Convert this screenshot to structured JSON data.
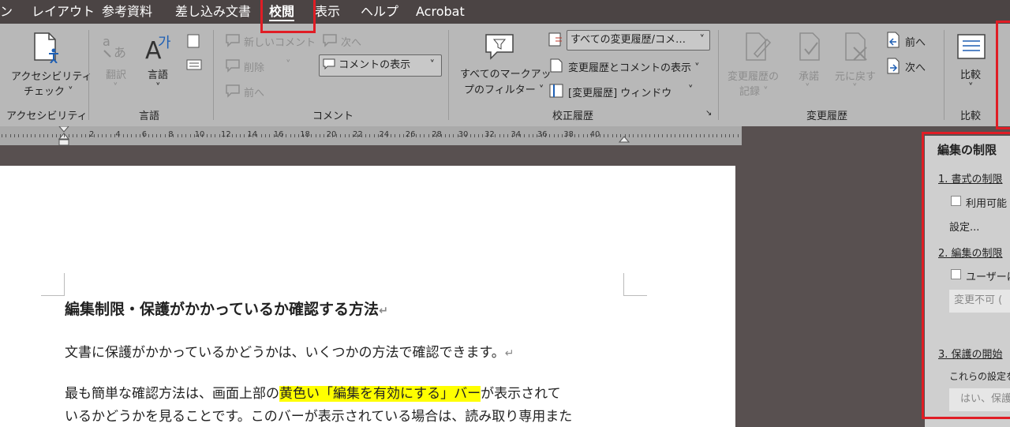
{
  "tabs": {
    "partial": "ン",
    "layout": "レイアウト",
    "references": "参考資料",
    "mailings": "差し込み文書",
    "review": "校閲",
    "view": "表示",
    "help": "ヘルプ",
    "acrobat": "Acrobat"
  },
  "ribbon": {
    "accessibility": {
      "btn_line1": "アクセシビリティ",
      "btn_line2": "チェック ˅",
      "group": "アクセシビリティ"
    },
    "language": {
      "translate": "翻訳",
      "language": "言語",
      "group": "言語"
    },
    "comments": {
      "new": "新しいコメント",
      "delete": "削除",
      "previous": "前へ",
      "next": "次へ",
      "show": "コメントの表示",
      "group": "コメント"
    },
    "tracking": {
      "filter_line1": "すべてのマークアッ",
      "filter_line2": "プのフィルター ˅",
      "dropdown": "すべての変更履歴/コメ…",
      "show_markup": "変更履歴とコメントの表示 ˅",
      "pane": "[変更履歴] ウィンドウ",
      "group": "校正履歴"
    },
    "changes": {
      "record_line1": "変更履歴の",
      "record_line2": "記録 ˅",
      "accept": "承諾",
      "reject": "元に戻す",
      "previous": "前へ",
      "next": "次へ",
      "group": "変更履歴"
    },
    "compare": {
      "btn": "比較",
      "group": "比較"
    }
  },
  "ruler": {
    "numbers": [
      "2",
      "4",
      "6",
      "8",
      "10",
      "12",
      "14",
      "16",
      "18",
      "20",
      "22",
      "24",
      "26",
      "28",
      "30",
      "32",
      "34",
      "36",
      "38",
      "40"
    ]
  },
  "document": {
    "heading": "編集制限・保護がかかっているか確認する方法",
    "para1": "文書に保護がかかっているかどうかは、いくつかの方法で確認できます。",
    "para2_a": "最も簡単な確認方法は、画面上部の",
    "para2_highlight": "黄色い「編集を有効にする」バー",
    "para2_b": "が表示されて",
    "para3": "いるかどうかを見ることです。このバーが表示されている場合は、読み取り専用また",
    "para_mark": "↵"
  },
  "pane": {
    "title": "編集の制限",
    "section1": "1. 書式の制限",
    "option1": "利用可能",
    "settings": "設定...",
    "section2": "2. 編集の制限",
    "option2": "ユーザーに",
    "field2": "変更不可 (",
    "section3": "3. 保護の開始",
    "note": "これらの設定を",
    "button": "はい、保護"
  },
  "colors": {
    "highlight": "#ffff00",
    "callout": "#e01d25"
  }
}
